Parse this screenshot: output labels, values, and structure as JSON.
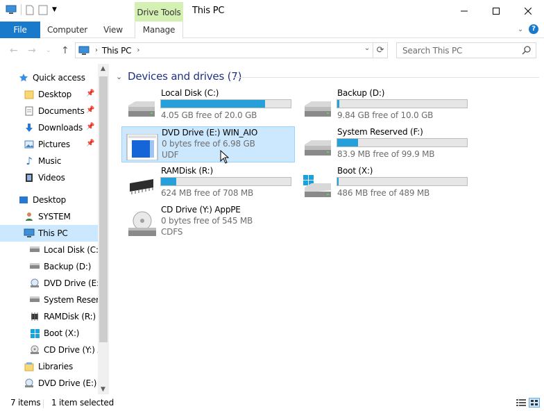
{
  "titlebar": {
    "context_tab": "Drive Tools",
    "title": "This PC"
  },
  "ribbon": {
    "tabs": [
      "File",
      "Computer",
      "View",
      "Manage"
    ]
  },
  "address": {
    "crumb": "This PC",
    "search_placeholder": "Search This PC"
  },
  "nav": {
    "quick_access": "Quick access",
    "quick_items": [
      "Desktop",
      "Documents",
      "Downloads",
      "Pictures",
      "Music",
      "Videos"
    ],
    "desktop": "Desktop",
    "system": "SYSTEM",
    "this_pc": "This PC",
    "drives": [
      "Local Disk (C:)",
      "Backup (D:)",
      "DVD Drive (E:) WIN_AIO",
      "System Reserved (F:)",
      "RAMDisk (R:)",
      "Boot (X:)",
      "CD Drive (Y:) AppPE"
    ],
    "libraries": "Libraries",
    "dvd_root": "DVD Drive (E:) WIN_AIO"
  },
  "group": {
    "title": "Devices and drives (7)"
  },
  "tiles": [
    {
      "name": "Local Disk (C:)",
      "free": "4.05 GB free of 20.0 GB",
      "used_fraction": 0.8
    },
    {
      "name": "Backup (D:)",
      "free": "9.84 GB free of 10.0 GB",
      "used_fraction": 0.016
    },
    {
      "name": "DVD Drive (E:) WIN_AIO",
      "line2": "0 bytes free of 6.98 GB",
      "line3": "UDF"
    },
    {
      "name": "System Reserved (F:)",
      "free": "83.9 MB free of 99.9 MB",
      "used_fraction": 0.16
    },
    {
      "name": "RAMDisk (R:)",
      "free": "624 MB free of 708 MB",
      "used_fraction": 0.12
    },
    {
      "name": "Boot (X:)",
      "free": "486 MB free of 489 MB",
      "used_fraction": 0.006
    },
    {
      "name": "CD Drive (Y:) AppPE",
      "line2": "0 bytes free of 545 MB",
      "line3": "CDFS"
    }
  ],
  "status": {
    "items": "7 items",
    "selected": "1 item selected"
  },
  "colors": {
    "accent": "#1979ca",
    "bar_fill": "#26a0da",
    "selection": "#cce8ff",
    "context_tab": "#d5f0b3",
    "group_title": "#1e3287"
  }
}
